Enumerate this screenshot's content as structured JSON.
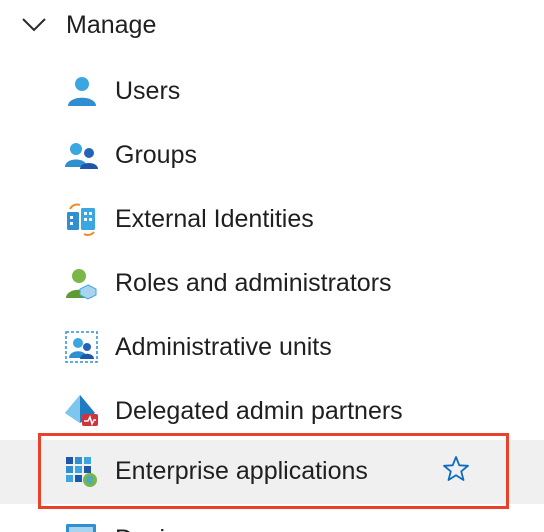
{
  "section": {
    "label": "Manage",
    "chevron_icon": "chevron-down-icon"
  },
  "items": [
    {
      "label": "Users",
      "icon": "user-icon"
    },
    {
      "label": "Groups",
      "icon": "groups-icon"
    },
    {
      "label": "External Identities",
      "icon": "external-identities-icon"
    },
    {
      "label": "Roles and administrators",
      "icon": "roles-icon"
    },
    {
      "label": "Administrative units",
      "icon": "administrative-units-icon"
    },
    {
      "label": "Delegated admin partners",
      "icon": "delegated-admin-icon"
    },
    {
      "label": "Enterprise applications",
      "icon": "enterprise-apps-icon",
      "selected": true,
      "favorite_icon": "star-outline-icon"
    },
    {
      "label": "Devices",
      "icon": "devices-icon"
    }
  ],
  "colors": {
    "highlight_border": "#e8412c",
    "selected_background": "#f0f0f0",
    "star": "#0f6cbd",
    "icon_blue": "#2f9ad8",
    "icon_green": "#7ab648"
  }
}
